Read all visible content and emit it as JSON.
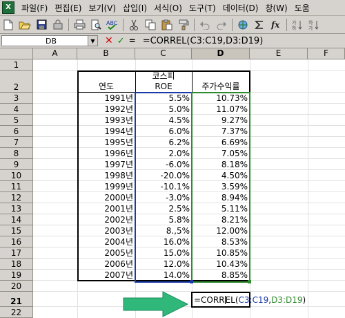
{
  "menu": {
    "items": [
      "파일(F)",
      "편집(E)",
      "보기(V)",
      "삽입(I)",
      "서식(O)",
      "도구(T)",
      "데이터(D)",
      "창(W)",
      "도움"
    ]
  },
  "toolbar": {
    "icons": [
      "new-icon",
      "open-icon",
      "save-icon",
      "permission-icon",
      "print-icon",
      "print-preview-icon",
      "spelling-icon",
      "cut-icon",
      "copy-icon",
      "paste-icon",
      "format-painter-icon",
      "undo-icon",
      "redo-icon",
      "hyperlink-icon",
      "autosum-icon",
      "function-icon",
      "sort-ascending-icon",
      "sort-descending-icon"
    ]
  },
  "formula_bar": {
    "name_box": "DB",
    "cancel_symbol": "✕",
    "enter_symbol": "✓",
    "equals_symbol": "=",
    "formula": "=CORREL(C3:C19,D3:D19)"
  },
  "columns": [
    "A",
    "B",
    "C",
    "D",
    "E",
    "F"
  ],
  "rows": [
    "1",
    "2",
    "3",
    "4",
    "5",
    "6",
    "7",
    "8",
    "9",
    "10",
    "11",
    "12",
    "13",
    "14",
    "15",
    "16",
    "17",
    "18",
    "19",
    "20",
    "21",
    "22"
  ],
  "table": {
    "header_year": "연도",
    "header_roe_line1": "코스피",
    "header_roe_line2": "ROE",
    "header_return": "주가수익률",
    "data": [
      {
        "year": "1991년",
        "roe": "5.5%",
        "ret": "10.73%"
      },
      {
        "year": "1992년",
        "roe": "5.0%",
        "ret": "11.07%"
      },
      {
        "year": "1993년",
        "roe": "4.5%",
        "ret": "9.27%"
      },
      {
        "year": "1994년",
        "roe": "6.0%",
        "ret": "7.37%"
      },
      {
        "year": "1995년",
        "roe": "6.2%",
        "ret": "6.69%"
      },
      {
        "year": "1996년",
        "roe": "2.0%",
        "ret": "7.05%"
      },
      {
        "year": "1997년",
        "roe": "-6.0%",
        "ret": "8.18%"
      },
      {
        "year": "1998년",
        "roe": "-20.0%",
        "ret": "4.50%"
      },
      {
        "year": "1999년",
        "roe": "-10.1%",
        "ret": "3.59%"
      },
      {
        "year": "2000년",
        "roe": "-3.0%",
        "ret": "8.94%"
      },
      {
        "year": "2001년",
        "roe": "2.5%",
        "ret": "5.11%"
      },
      {
        "year": "2002년",
        "roe": "5.8%",
        "ret": "8.21%"
      },
      {
        "year": "2003년",
        "roe": "8.,5%",
        "ret": "12.00%"
      },
      {
        "year": "2004년",
        "roe": "16.0%",
        "ret": "8.53%"
      },
      {
        "year": "2005년",
        "roe": "15.0%",
        "ret": "10.85%"
      },
      {
        "year": "2006년",
        "roe": "12.0%",
        "ret": "10.43%"
      },
      {
        "year": "2007년",
        "roe": "14.0%",
        "ret": "8.85%"
      }
    ]
  },
  "active_cell": {
    "prefix": "=CORR",
    "suffix": "EL(",
    "ref_c": "C3:C19",
    "comma": ",",
    "ref_d": "D3:D19",
    "close": ")"
  },
  "colors": {
    "arrow": "#2fb87a",
    "ref_c": "#1a3aa8",
    "ref_d": "#2d8a2d"
  }
}
